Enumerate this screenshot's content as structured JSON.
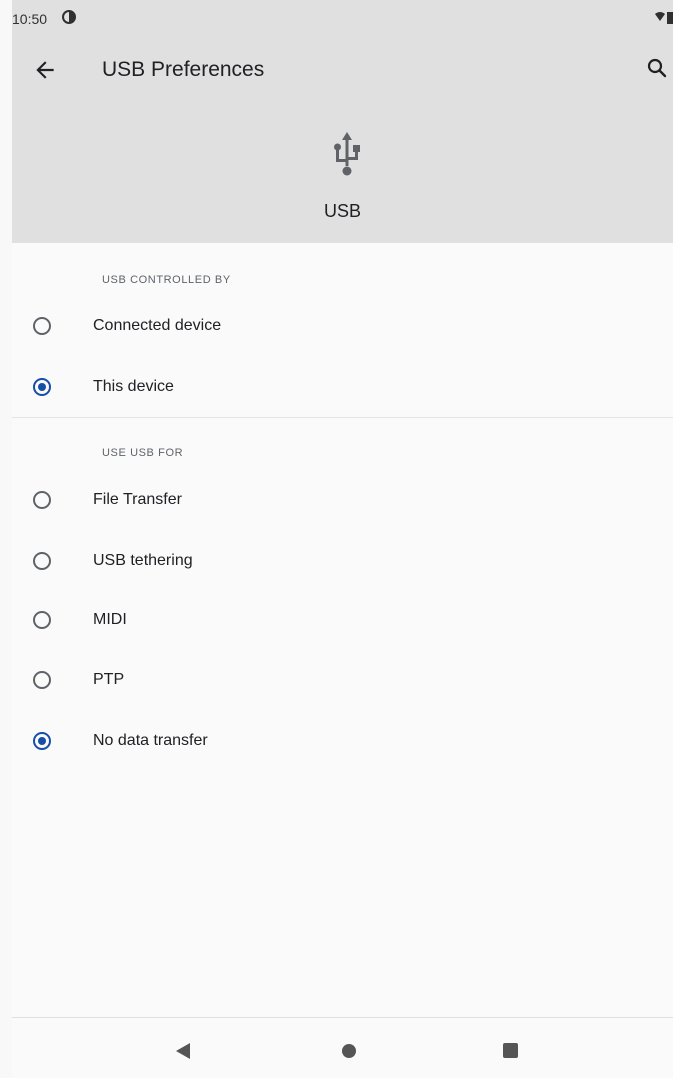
{
  "status_bar": {
    "time": "10:50"
  },
  "header": {
    "title": "USB Preferences",
    "icon_label": "USB"
  },
  "controlled_by": {
    "header": "USB CONTROLLED BY",
    "options": [
      {
        "label": "Connected device",
        "checked": false
      },
      {
        "label": "This device",
        "checked": true
      }
    ]
  },
  "use_usb_for": {
    "header": "USE USB FOR",
    "options": [
      {
        "label": "File Transfer",
        "checked": false
      },
      {
        "label": "USB tethering",
        "checked": false
      },
      {
        "label": "MIDI",
        "checked": false
      },
      {
        "label": "PTP",
        "checked": false
      },
      {
        "label": "No data transfer",
        "checked": true
      }
    ]
  },
  "colors": {
    "appbar": "#e0e0e0",
    "background": "#fafafa",
    "accent": "#174ea6",
    "icon": "#5f6368"
  }
}
